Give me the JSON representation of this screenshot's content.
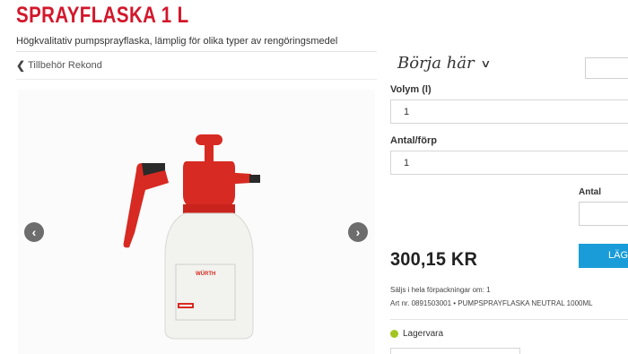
{
  "product": {
    "title": "SPRAYFLASKA 1 L",
    "description": "Högkvalitativ pumpsprayflaska, lämplig för olika typer av rengöringsmedel",
    "image_brand": "WÜRTH"
  },
  "breadcrumb": {
    "back_label": "Tillbehör Rekond"
  },
  "start_menu": {
    "label": "Börja här"
  },
  "options": {
    "volym_label": "Volym (l)",
    "volym_value": "1",
    "antal_forp_label": "Antal/förp",
    "antal_forp_value": "1"
  },
  "purchase": {
    "antal_label": "Antal",
    "price": "300,15 KR",
    "buy_button_label": "LÄGG"
  },
  "details": {
    "sold_in": "Säljs i hela förpackningar om: 1",
    "article": "Art nr. 0891503001 • PUMPSPRAYFLASKA NEUTRAL 1000ML"
  },
  "stock": {
    "status": "Lagervara",
    "status_color": "#a3c521"
  },
  "colors": {
    "brand_red": "#d3172b",
    "accent_blue": "#1a9cd8"
  },
  "icons": {
    "back": "chevron-left-icon",
    "dropdown": "chevron-down-icon",
    "gallery_prev": "arrow-left-icon",
    "gallery_next": "arrow-right-icon"
  }
}
